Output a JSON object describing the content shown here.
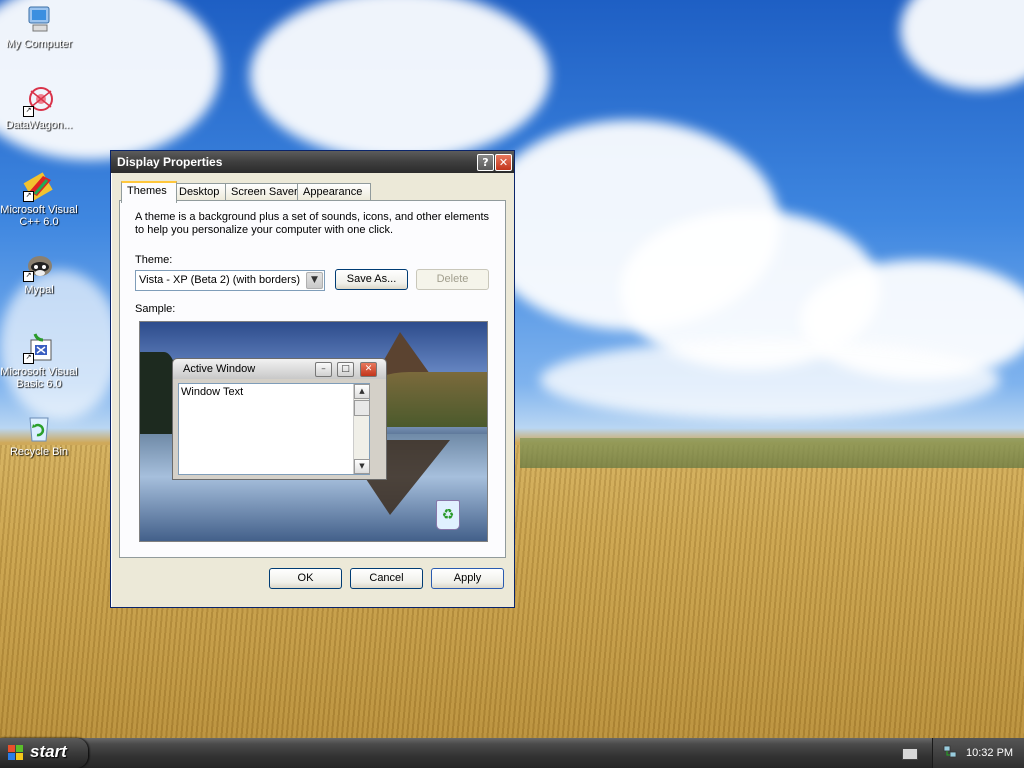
{
  "desktop": {
    "icons": [
      {
        "label": "My Computer"
      },
      {
        "label": "DataWagon..."
      },
      {
        "label": "Microsoft Visual C++ 6.0"
      },
      {
        "label": "Mypal"
      },
      {
        "label": "Microsoft Visual Basic 6.0"
      },
      {
        "label": "Recycle Bin"
      }
    ]
  },
  "dialog": {
    "title": "Display Properties",
    "help_button": "?",
    "close_button": "✕",
    "tabs": [
      {
        "label": "Themes",
        "active": true
      },
      {
        "label": "Desktop"
      },
      {
        "label": "Screen Saver"
      },
      {
        "label": "Appearance"
      }
    ],
    "description": "A theme is a background plus a set of sounds, icons, and other elements to help you personalize your computer with one click.",
    "theme_label": "Theme:",
    "theme_value": "Vista - XP (Beta 2) (with borders)",
    "save_as_label": "Save As...",
    "delete_label": "Delete",
    "sample_label": "Sample:",
    "sample": {
      "window_title": "Active Window",
      "window_text": "Window Text"
    },
    "ok_label": "OK",
    "cancel_label": "Cancel",
    "apply_label": "Apply"
  },
  "taskbar": {
    "start_label": "start",
    "clock": "10:32 PM"
  }
}
